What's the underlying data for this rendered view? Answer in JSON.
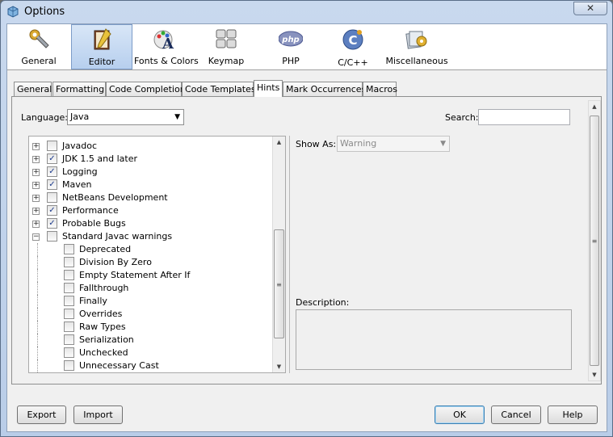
{
  "window": {
    "title": "Options",
    "close_glyph": "✕"
  },
  "categories": [
    {
      "label": "General",
      "icon": "wrench-gear-icon"
    },
    {
      "label": "Editor",
      "icon": "editor-book-icon",
      "selected": true
    },
    {
      "label": "Fonts & Colors",
      "icon": "fonts-colors-icon"
    },
    {
      "label": "Keymap",
      "icon": "keyboard-icon"
    },
    {
      "label": "PHP",
      "icon": "php-icon"
    },
    {
      "label": "C/C++",
      "icon": "cpp-icon"
    },
    {
      "label": "Miscellaneous",
      "icon": "miscellaneous-icon"
    }
  ],
  "tabs": [
    "General",
    "Formatting",
    "Code Completion",
    "Code Templates",
    "Hints",
    "Mark Occurrences",
    "Macros"
  ],
  "active_tab": "Hints",
  "hints": {
    "language_label": "Language:",
    "language_value": "Java",
    "search_label": "Search:",
    "search_value": "",
    "show_as_label": "Show As:",
    "show_as_value": "Warning",
    "description_label": "Description:",
    "tree": [
      {
        "label": "Javadoc",
        "checked": false,
        "expander": "+"
      },
      {
        "label": "JDK 1.5 and later",
        "checked": true,
        "expander": "+"
      },
      {
        "label": "Logging",
        "checked": true,
        "expander": "+"
      },
      {
        "label": "Maven",
        "checked": true,
        "expander": "+"
      },
      {
        "label": "NetBeans Development",
        "checked": false,
        "expander": "+"
      },
      {
        "label": "Performance",
        "checked": true,
        "expander": "+"
      },
      {
        "label": "Probable Bugs",
        "checked": true,
        "expander": "+"
      },
      {
        "label": "Standard Javac warnings",
        "checked": false,
        "expander": "−"
      },
      {
        "label": "Deprecated",
        "checked": false,
        "child": true
      },
      {
        "label": "Division By Zero",
        "checked": false,
        "child": true
      },
      {
        "label": "Empty Statement After If",
        "checked": false,
        "child": true
      },
      {
        "label": "Fallthrough",
        "checked": false,
        "child": true
      },
      {
        "label": "Finally",
        "checked": false,
        "child": true
      },
      {
        "label": "Overrides",
        "checked": false,
        "child": true
      },
      {
        "label": "Raw Types",
        "checked": false,
        "child": true
      },
      {
        "label": "Serialization",
        "checked": false,
        "child": true
      },
      {
        "label": "Unchecked",
        "checked": false,
        "child": true
      },
      {
        "label": "Unnecessary Cast",
        "checked": false,
        "child": true
      }
    ]
  },
  "buttons": {
    "export": "Export",
    "import": "Import",
    "ok": "OK",
    "cancel": "Cancel",
    "help": "Help"
  }
}
